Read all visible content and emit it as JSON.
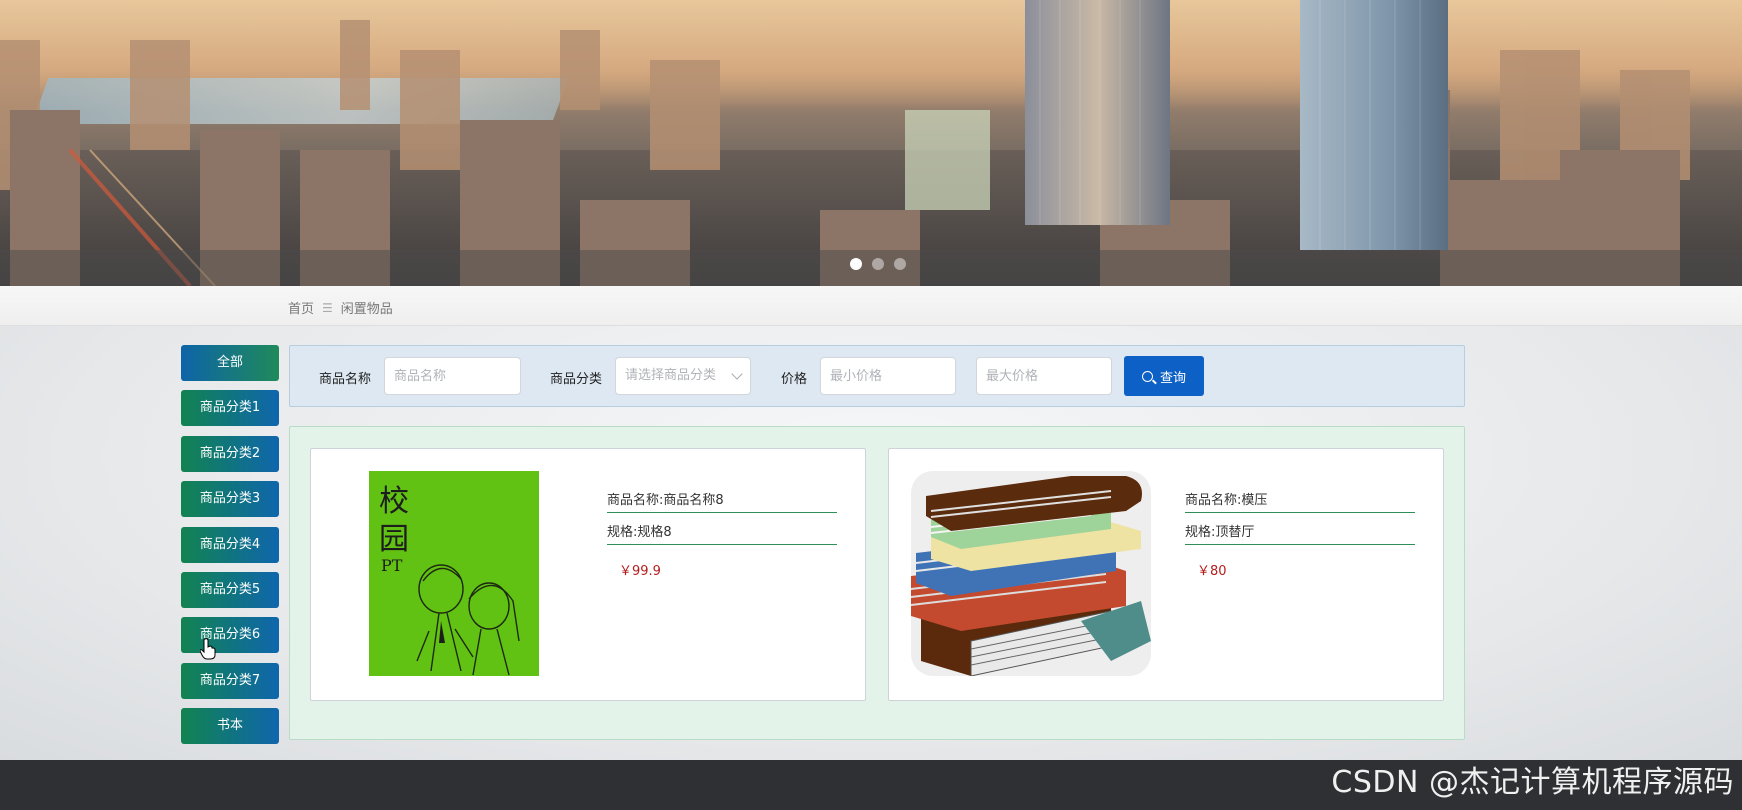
{
  "breadcrumb": {
    "home": "首页",
    "separator": "☰",
    "current": "闲置物品"
  },
  "sidebar": {
    "items": [
      {
        "label": "全部"
      },
      {
        "label": "商品分类1"
      },
      {
        "label": "商品分类2"
      },
      {
        "label": "商品分类3"
      },
      {
        "label": "商品分类4"
      },
      {
        "label": "商品分类5"
      },
      {
        "label": "商品分类6"
      },
      {
        "label": "商品分类7"
      },
      {
        "label": "书本"
      }
    ]
  },
  "search": {
    "name_label": "商品名称",
    "name_placeholder": "商品名称",
    "category_label": "商品分类",
    "category_placeholder": "请选择商品分类",
    "price_label": "价格",
    "min_price_placeholder": "最小价格",
    "max_price_placeholder": "最大价格",
    "query_button": "查询"
  },
  "products": [
    {
      "name": "商品名称:商品名称8",
      "spec": "规格:规格8",
      "price": "￥99.9",
      "image_icon": "green-comic-book-cover"
    },
    {
      "name": "商品名称:模压",
      "spec": "规格:顶替厅",
      "price": "￥80",
      "image_icon": "book-stack-icon"
    }
  ],
  "carousel": {
    "slides": 3,
    "active": 0
  },
  "watermark": "CSDN @杰记计算机程序源码",
  "colors": {
    "accent_blue": "#0d61c6",
    "price_red": "#b71c1c",
    "divider_green": "#2f8f5a"
  }
}
